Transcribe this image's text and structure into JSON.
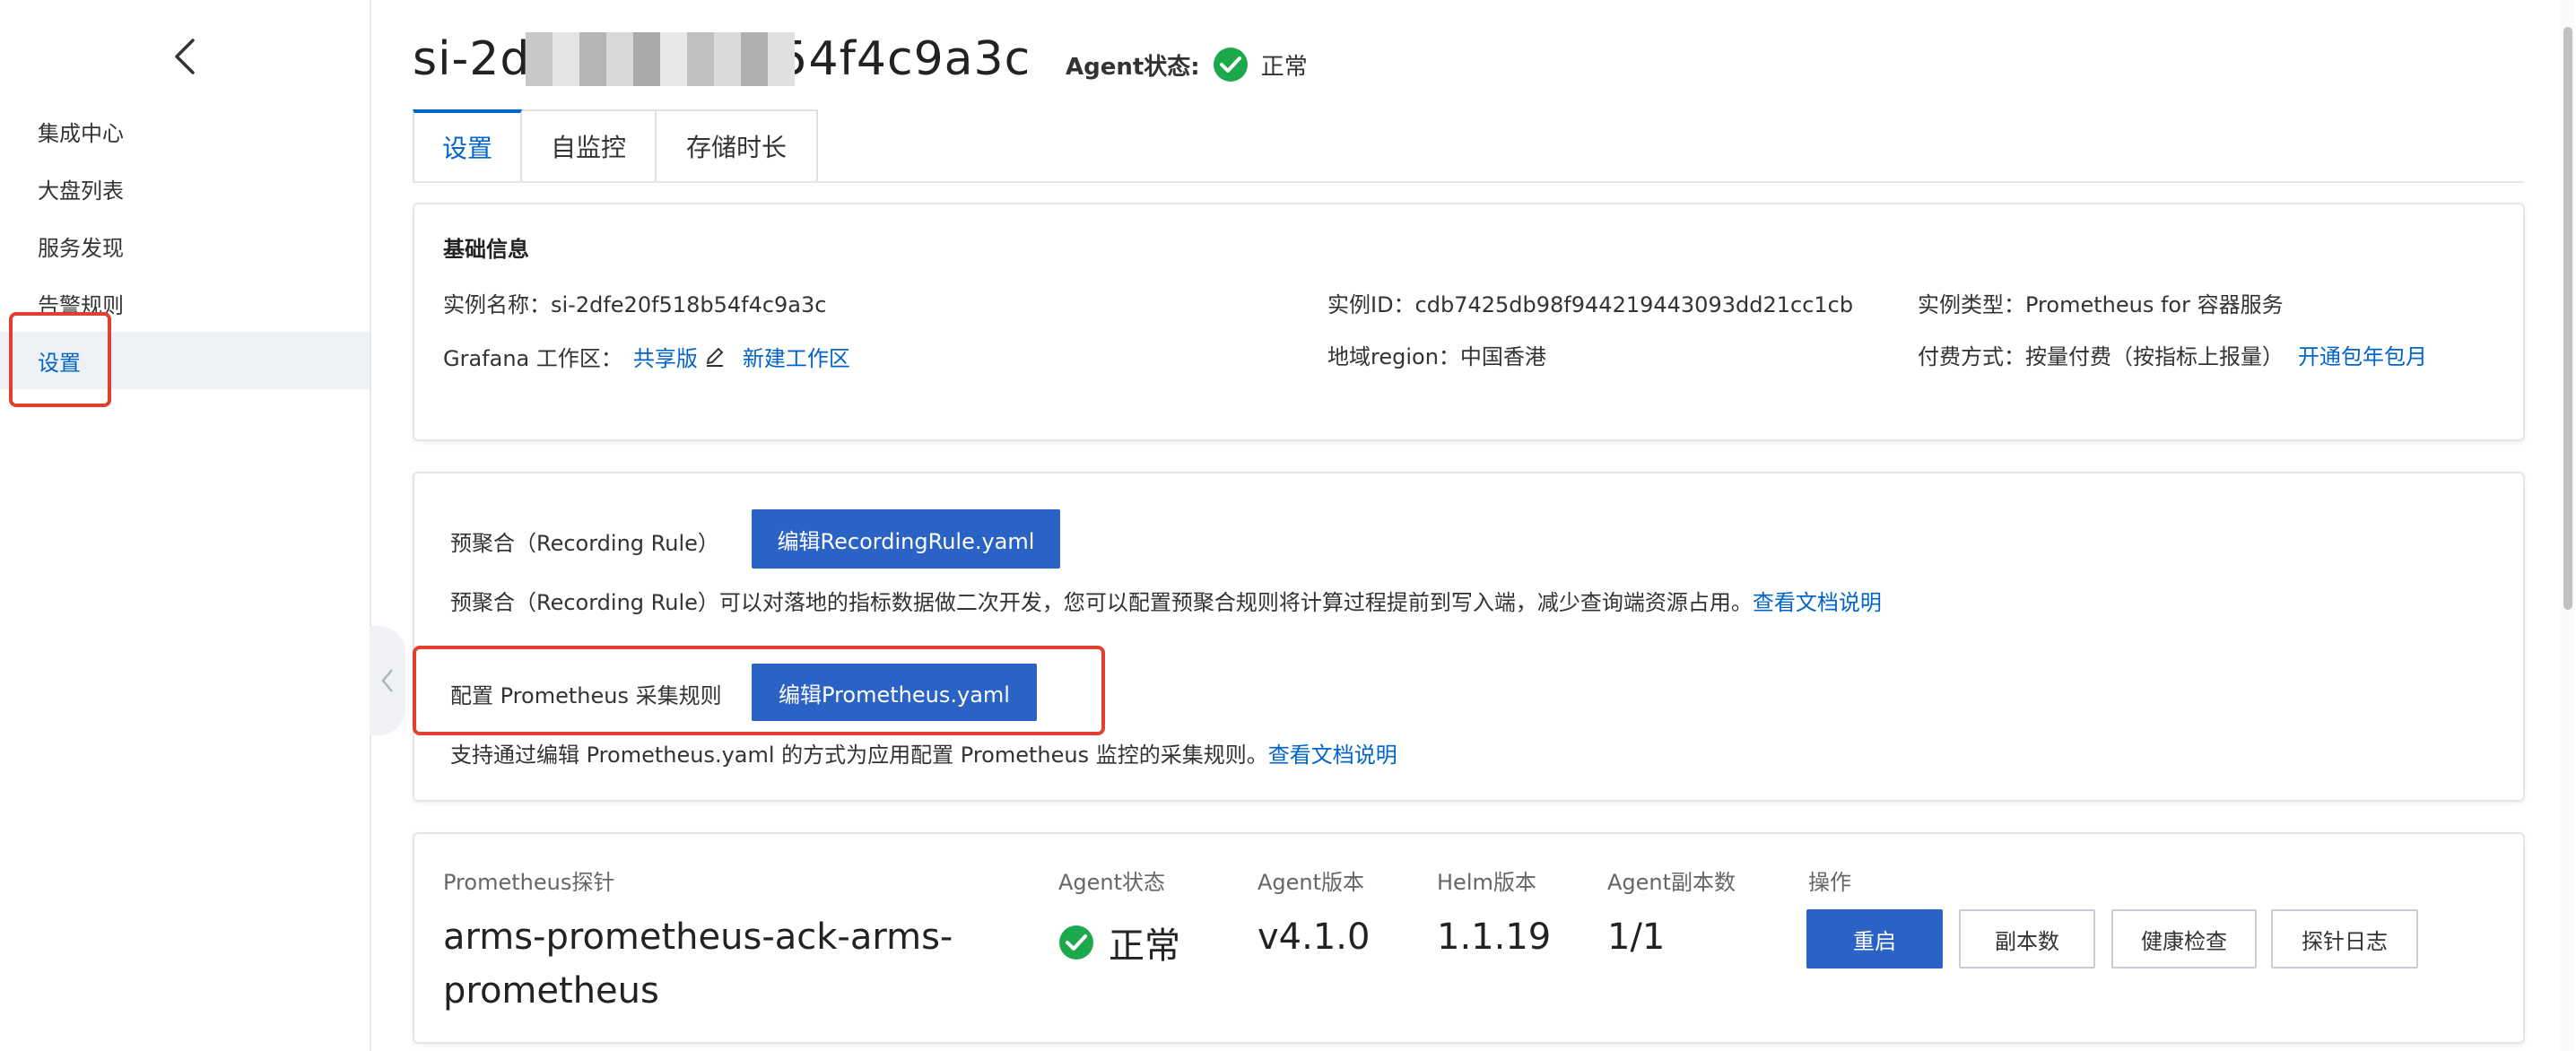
{
  "sidebar": {
    "items": [
      {
        "label": "集成中心"
      },
      {
        "label": "大盘列表"
      },
      {
        "label": "服务发现"
      },
      {
        "label": "告警规则"
      },
      {
        "label": "设置"
      }
    ]
  },
  "header": {
    "instance_title": "si-2dfe20f518b54f4c9a3c",
    "agent_status_label": "Agent状态:",
    "agent_status_value": "正常"
  },
  "tabs": [
    {
      "label": "设置"
    },
    {
      "label": "自监控"
    },
    {
      "label": "存储时长"
    }
  ],
  "basic_info": {
    "title": "基础信息",
    "instance_name": "实例名称：si-2dfe20f518b54f4c9a3c",
    "instance_id": "实例ID：cdb7425db98f944219443093dd21cc1cb",
    "instance_type": "实例类型：Prometheus for 容器服务",
    "grafana_label": "Grafana 工作区：",
    "grafana_shared": "共享版",
    "grafana_new": "新建工作区",
    "region": "地域region：中国香港",
    "billing": "付费方式：按量付费（按指标上报量）",
    "billing_link": "开通包年包月"
  },
  "rules": {
    "recording_label": "预聚合（Recording Rule）",
    "recording_button": "编辑RecordingRule.yaml",
    "recording_desc": "预聚合（Recording Rule）可以对落地的指标数据做二次开发，您可以配置预聚合规则将计算过程提前到写入端，减少查询端资源占用。",
    "recording_link": "查看文档说明",
    "prom_label": "配置 Prometheus 采集规则",
    "prom_button": "编辑Prometheus.yaml",
    "prom_desc": "支持通过编辑 Prometheus.yaml 的方式为应用配置 Prometheus 监控的采集规则。",
    "prom_link": "查看文档说明"
  },
  "probe": {
    "headers": {
      "name": "Prometheus探针",
      "agent_status": "Agent状态",
      "agent_version": "Agent版本",
      "helm_version": "Helm版本",
      "replicas": "Agent副本数",
      "actions": "操作"
    },
    "row": {
      "name_line1": "arms-prometheus-ack-arms-",
      "name_line2": "prometheus",
      "status": "正常",
      "agent_version": "v4.1.0",
      "helm_version": "1.1.19",
      "replicas": "1/1"
    },
    "buttons": {
      "restart": "重启",
      "replicas": "副本数",
      "health": "健康检查",
      "log": "探针日志"
    }
  },
  "colors": {
    "primary": "#2a63c5",
    "link": "#0064c8",
    "success": "#1ba94c",
    "highlight": "#e2402f"
  }
}
